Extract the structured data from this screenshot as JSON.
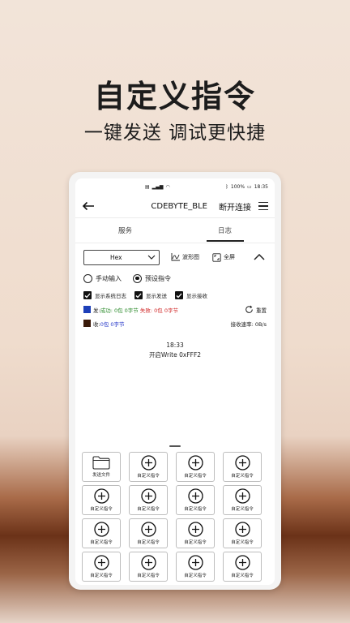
{
  "promo": {
    "headline": "自定义指令",
    "subline": "一键发送 调试更快捷"
  },
  "statusbar": {
    "left": "₿ᴰ ▪ᵢₗ ▪ᵢₗ",
    "battery": "100%",
    "time": "18:35"
  },
  "appbar": {
    "title": "CDEBYTE_BLE",
    "disconnect": "断开连接"
  },
  "tabs": [
    {
      "label": "服务",
      "active": false
    },
    {
      "label": "日志",
      "active": true
    }
  ],
  "toolbar": {
    "format": "Hex",
    "waveform": "波形图",
    "fullscreen": "全屏"
  },
  "input_mode": {
    "manual": "手动输入",
    "preset": "预设指令",
    "selected": "preset"
  },
  "display_options": [
    {
      "label": "显示系统日志",
      "checked": true
    },
    {
      "label": "显示发送",
      "checked": true
    },
    {
      "label": "显示接收",
      "checked": true
    }
  ],
  "send_stats": {
    "color": "#1d3fb8",
    "label": "发:",
    "success": "成功: 0包 0字节",
    "fail": "失败: 0包 0字节",
    "reset": "重置"
  },
  "recv_stats": {
    "color": "#3a1a0a",
    "label": "收:",
    "value": "0包 0字节",
    "rate": "接收速率:  0B/s"
  },
  "log": {
    "time": "18:33",
    "message": "开启Write 0xFFF2"
  },
  "buttons": {
    "send_file": "发送文件",
    "custom": "自定义指令"
  }
}
